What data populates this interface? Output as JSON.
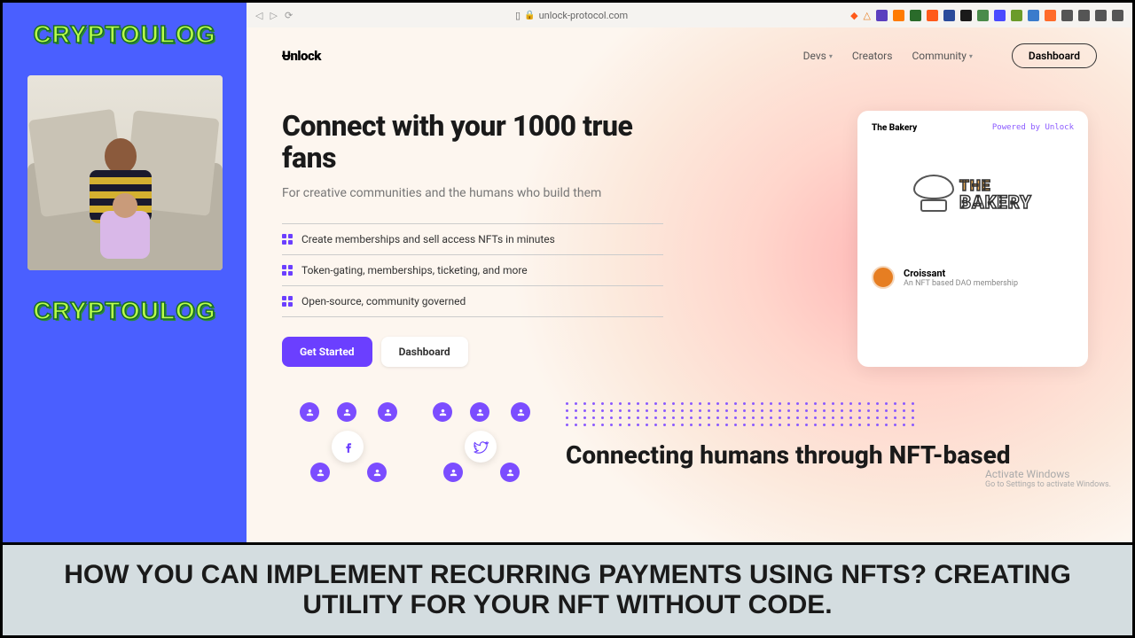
{
  "sidebar": {
    "brand_top": "CRYPTOULOG",
    "brand_bottom": "CRYPTOULOG"
  },
  "browser": {
    "url": "unlock-protocol.com",
    "ext_colors": [
      "#5b3fbf",
      "#ff7b00",
      "#2a6b2a",
      "#ff5a1a",
      "#2a4b9b",
      "#1a1a1a",
      "#4a8b4a",
      "#4a4aff",
      "#6b9b2a",
      "#3a7bcc",
      "#ff6b2a",
      "#555",
      "#555",
      "#555",
      "#555"
    ]
  },
  "nav": {
    "logo": "Unlock",
    "items": [
      {
        "label": "Devs",
        "dropdown": true
      },
      {
        "label": "Creators",
        "dropdown": false
      },
      {
        "label": "Community",
        "dropdown": true
      }
    ],
    "dashboard": "Dashboard"
  },
  "hero": {
    "title": "Connect with your 1000 true fans",
    "subtitle": "For creative communities and the humans who build them",
    "features": [
      "Create memberships and sell access NFTs in minutes",
      "Token-gating, memberships, ticketing, and more",
      "Open-source, community governed"
    ],
    "cta_primary": "Get Started",
    "cta_secondary": "Dashboard"
  },
  "card": {
    "title": "The Bakery",
    "powered": "Powered by Unlock",
    "logo_line1": "THE",
    "logo_line2": "BAKERY",
    "item_name": "Croissant",
    "item_desc": "An NFT based DAO membership"
  },
  "lower": {
    "dot_count": 160,
    "headline": "Connecting humans through NFT-based"
  },
  "watermark": {
    "line1": "Activate Windows",
    "line2": "Go to Settings to activate Windows."
  },
  "banner": {
    "text": "HOW YOU CAN IMPLEMENT RECURRING PAYMENTS USING NFTS? CREATING UTILITY FOR YOUR NFT WITHOUT CODE."
  }
}
